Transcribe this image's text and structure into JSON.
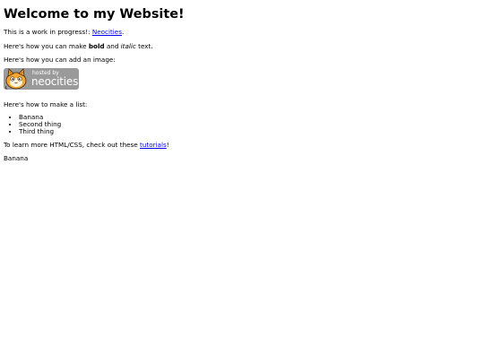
{
  "page": {
    "heading": "Welcome to my Website!",
    "intro": {
      "prefix": "This is a work in progress!: ",
      "link": "Neocities",
      "suffix": "."
    },
    "bold_line": {
      "before": "Here's how you can make ",
      "bold": "bold",
      "middle": " and ",
      "italic": "italic",
      "after": " text."
    },
    "image_line": "Here's how you can add an image:",
    "badge": {
      "small_text": "hosted by",
      "big_text": "neocities"
    },
    "list_intro": "Here's how to make a list:",
    "list_items": [
      "Banana",
      "Second thing",
      "Third thing"
    ],
    "tutorial_line": {
      "prefix": "To learn more HTML/CSS, check out these ",
      "link": "tutorials",
      "suffix": "!"
    },
    "footer_text": "Banana"
  },
  "colors": {
    "link": "#0000ee",
    "badge_bg": "#9a9a9a",
    "text": "#000000"
  }
}
